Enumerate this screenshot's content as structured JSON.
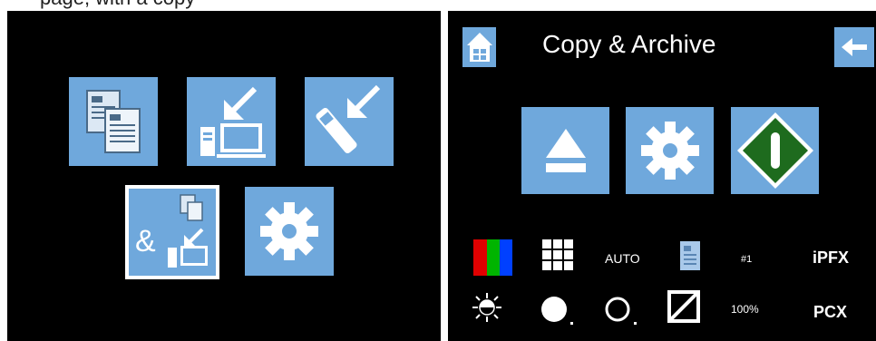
{
  "caption": {
    "text": "page, with a copy"
  },
  "left_panel": {
    "tiles": [
      {
        "icon": "document-copy-icon"
      },
      {
        "icon": "scan-to-pc-icon"
      },
      {
        "icon": "scan-to-usb-icon"
      },
      {
        "icon": "copy-and-archive-icon",
        "symbol": "&",
        "selected": true
      },
      {
        "icon": "gear-icon"
      }
    ]
  },
  "right_panel": {
    "header": {
      "title": "Copy & Archive",
      "home_icon": "home-icon",
      "back_icon": "back-arrow-icon"
    },
    "actions": [
      {
        "icon": "eject-icon"
      },
      {
        "icon": "gear-icon"
      },
      {
        "icon": "start-icon"
      }
    ],
    "settings_row1": {
      "color_mode_icon": "color-mode-icon",
      "resolution_grid_icon": "grid-icon",
      "paper_size": "AUTO",
      "document_icon": "document-icon",
      "copies": "#1",
      "file_format": "iPFX"
    },
    "settings_row2": {
      "brightness_icon": "brightness-icon",
      "filled_circle_icon": "filled-circle-icon",
      "open_circle_icon": "open-circle-icon",
      "contrast_icon": "contrast-square-icon",
      "zoom": "100%",
      "archive_format": "PCX"
    }
  },
  "colors": {
    "tile_blue": "#6fa8dc",
    "start_green": "#1e6b1e",
    "background": "#000000"
  }
}
